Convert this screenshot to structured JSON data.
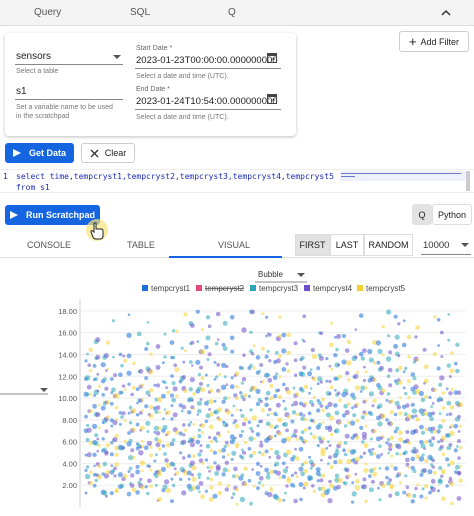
{
  "top_tabs": [
    "Query",
    "SQL",
    "Q"
  ],
  "query_panel": {
    "table_value": "sensors",
    "table_help": "Select a table",
    "var_value": "s1",
    "var_help": "Set a variable name to be used in the scratchpad",
    "start_label": "Start Date *",
    "start_value": "2023-01-23T00:00:00.000000000",
    "start_help": "Select a date and time (UTC).",
    "end_label": "End Date *",
    "end_value": "2023-01-24T10:54:00.000000000",
    "end_help": "Select a date and time (UTC)."
  },
  "buttons": {
    "add_filter": "Add Filter",
    "get_data": "Get Data",
    "clear": "Clear",
    "run_scratchpad": "Run Scratchpad",
    "q": "Q",
    "python": "Python"
  },
  "editor": {
    "line_number": "1",
    "line1": "select time,tempcryst1,tempcryst2,tempcryst3,tempcryst4,tempcryst5",
    "line2": "from s1"
  },
  "results_tabs": [
    "CONSOLE",
    "TABLE",
    "VISUAL"
  ],
  "paging": {
    "first": "FIRST",
    "last": "LAST",
    "random": "RANDOM",
    "rows": "10000"
  },
  "chart_type_select": "Bubble",
  "chart_data": {
    "type": "scatter",
    "chart_style": "bubble",
    "series": [
      {
        "name": "tempcryst1",
        "color": "#1e6fd9"
      },
      {
        "name": "tempcryst2",
        "color": "#e8457a"
      },
      {
        "name": "tempcryst3",
        "color": "#29a7b8"
      },
      {
        "name": "tempcryst4",
        "color": "#6b4fc8"
      },
      {
        "name": "tempcryst5",
        "color": "#f5d130"
      }
    ],
    "hidden_series": [
      "tempcryst2"
    ],
    "y_ticks": [
      "18.00",
      "16.00",
      "14.00",
      "12.00",
      "10.00",
      "8.00",
      "6.00",
      "4.00",
      "2.00"
    ],
    "ylim": [
      0,
      19
    ],
    "legend_position": "top",
    "grid": true
  }
}
